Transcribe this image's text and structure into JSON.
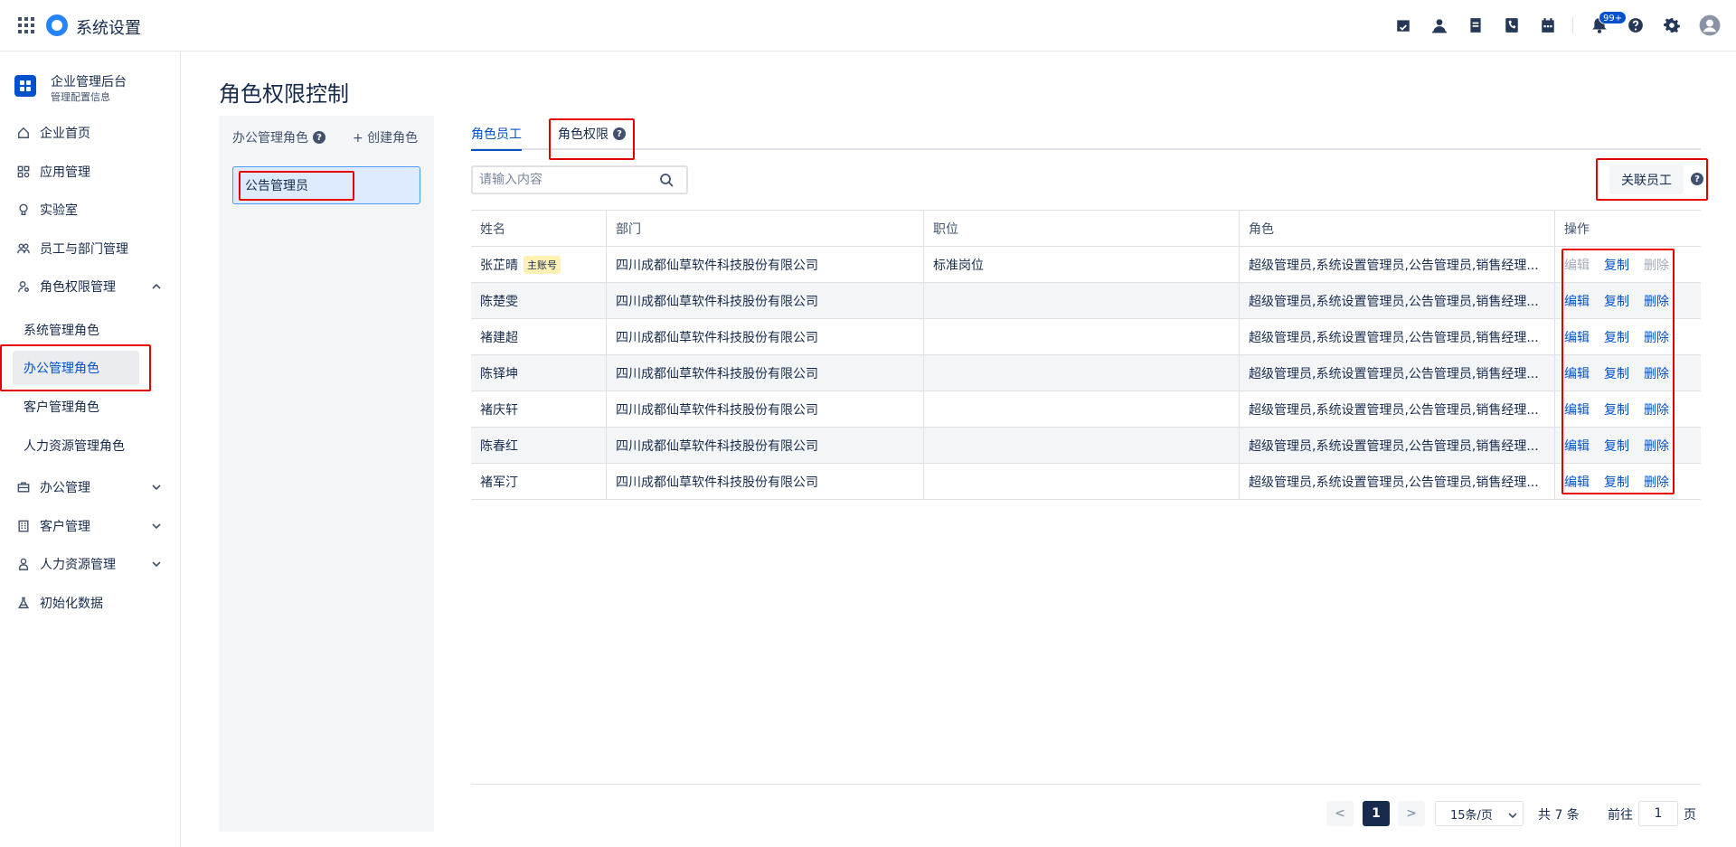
{
  "app": {
    "title": "系统设置"
  },
  "topbar": {
    "icons": [
      "check-calendar-icon",
      "user-icon",
      "document-icon",
      "phone-icon",
      "calendar-icon",
      "bell-icon",
      "help-icon",
      "gear-icon",
      "avatar-icon"
    ],
    "notification_badge": "99+"
  },
  "sidebar": {
    "org_title": "企业管理后台",
    "org_subtitle": "管理配置信息",
    "items": [
      {
        "label": "企业首页",
        "icon": "home-icon"
      },
      {
        "label": "应用管理",
        "icon": "apps-icon"
      },
      {
        "label": "实验室",
        "icon": "bulb-icon"
      },
      {
        "label": "员工与部门管理",
        "icon": "team-icon"
      },
      {
        "label": "角色权限管理",
        "icon": "role-icon",
        "expanded": true
      },
      {
        "label": "办公管理",
        "icon": "briefcase-icon"
      },
      {
        "label": "客户管理",
        "icon": "building-icon"
      },
      {
        "label": "人力资源管理",
        "icon": "person-icon"
      },
      {
        "label": "初始化数据",
        "icon": "flask-icon"
      }
    ],
    "sub_items": [
      {
        "label": "系统管理角色"
      },
      {
        "label": "办公管理角色",
        "active": true
      },
      {
        "label": "客户管理角色"
      },
      {
        "label": "人力资源管理角色"
      }
    ]
  },
  "page": {
    "title": "角色权限控制"
  },
  "roles_panel": {
    "header": "办公管理角色",
    "create_label": "+ 创建角色",
    "selected_role": "公告管理员"
  },
  "tabs": [
    {
      "label": "角色员工",
      "active": true
    },
    {
      "label": "角色权限",
      "active": false
    }
  ],
  "toolbar": {
    "search_placeholder": "请输入内容",
    "link_button": "关联员工"
  },
  "table": {
    "columns": [
      "姓名",
      "部门",
      "职位",
      "角色",
      "操作"
    ],
    "rows": [
      {
        "name": "张芷晴",
        "tag": "主账号",
        "dept": "四川成都仙草软件科技股份有限公司",
        "position": "标准岗位",
        "roles": "超级管理员,系统设置管理员,公告管理员,销售经理...",
        "edit_disabled": true,
        "delete_disabled": true
      },
      {
        "name": "陈楚雯",
        "tag": "",
        "dept": "四川成都仙草软件科技股份有限公司",
        "position": "",
        "roles": "超级管理员,系统设置管理员,公告管理员,销售经理..."
      },
      {
        "name": "褚建超",
        "tag": "",
        "dept": "四川成都仙草软件科技股份有限公司",
        "position": "",
        "roles": "超级管理员,系统设置管理员,公告管理员,销售经理..."
      },
      {
        "name": "陈铎坤",
        "tag": "",
        "dept": "四川成都仙草软件科技股份有限公司",
        "position": "",
        "roles": "超级管理员,系统设置管理员,公告管理员,销售经理..."
      },
      {
        "name": "褚庆轩",
        "tag": "",
        "dept": "四川成都仙草软件科技股份有限公司",
        "position": "",
        "roles": "超级管理员,系统设置管理员,公告管理员,销售经理..."
      },
      {
        "name": "陈春红",
        "tag": "",
        "dept": "四川成都仙草软件科技股份有限公司",
        "position": "",
        "roles": "超级管理员,系统设置管理员,公告管理员,销售经理..."
      },
      {
        "name": "褚军汀",
        "tag": "",
        "dept": "四川成都仙草软件科技股份有限公司",
        "position": "",
        "roles": "超级管理员,系统设置管理员,公告管理员,销售经理..."
      }
    ],
    "actions": {
      "edit": "编辑",
      "copy": "复制",
      "delete": "删除"
    }
  },
  "pagination": {
    "prev": "<",
    "current": "1",
    "next": ">",
    "page_size": "15条/页",
    "total": "共 7 条",
    "goto_label": "前往",
    "goto_value": "1",
    "page_suffix": "页"
  },
  "colors": {
    "accent": "#0052cc",
    "highlight": "#e60000",
    "tag_bg": "#fff0b3"
  }
}
